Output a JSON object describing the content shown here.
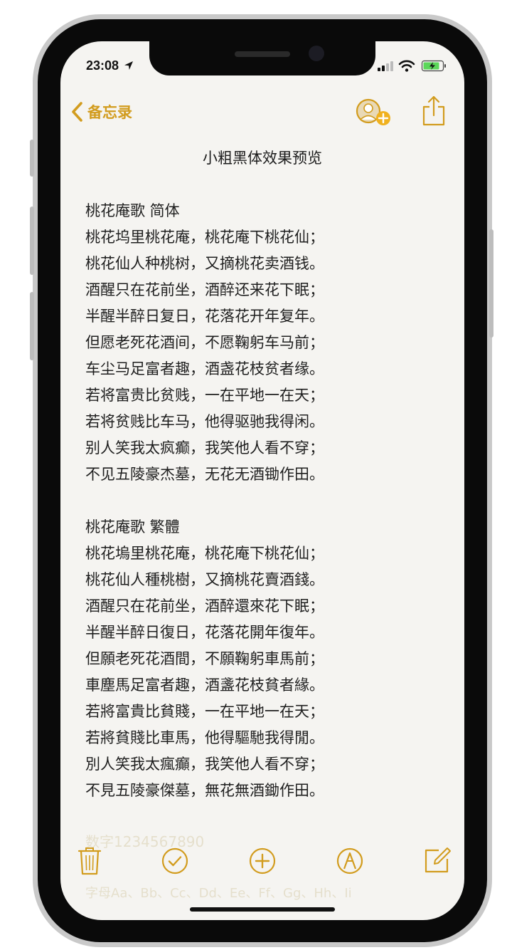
{
  "status_bar": {
    "time": "23:08"
  },
  "nav": {
    "back_label": "备忘录"
  },
  "note": {
    "title": "小粗黑体效果预览",
    "sections": [
      {
        "heading": "桃花庵歌  简体",
        "lines": [
          "桃花坞里桃花庵，桃花庵下桃花仙；",
          "桃花仙人种桃树，又摘桃花卖酒钱。",
          "酒醒只在花前坐，酒醉还来花下眠；",
          "半醒半醉日复日，花落花开年复年。",
          "但愿老死花酒间，不愿鞠躬车马前；",
          "车尘马足富者趣，酒盏花枝贫者缘。",
          "若将富贵比贫贱，一在平地一在天；",
          "若将贫贱比车马，他得驱驰我得闲。",
          "别人笑我太疯癫，我笑他人看不穿；",
          "不见五陵豪杰墓，无花无酒锄作田。"
        ]
      },
      {
        "heading": "桃花庵歌  繁體",
        "lines": [
          "桃花塢里桃花庵，桃花庵下桃花仙；",
          "桃花仙人種桃樹，又摘桃花賣酒錢。",
          "酒醒只在花前坐，酒醉還來花下眠；",
          "半醒半醉日復日，花落花開年復年。",
          "但願老死花酒間，不願鞠躬車馬前；",
          "車塵馬足富者趣，酒盞花枝貧者緣。",
          "若將富貴比貧賤，一在平地一在天；",
          "若將貧賤比車馬，他得驅馳我得閒。",
          "別人笑我太瘋癲，我笑他人看不穿；",
          "不見五陵豪傑墓，無花無酒鋤作田。"
        ]
      }
    ],
    "faded_lines": [
      "数字1234567890",
      "字母Aa、Bb、Cc、Dd、Ee、Ff、Gg、Hh、Ii"
    ]
  },
  "colors": {
    "accent": "#d29c1e",
    "text": "#1f1f1f",
    "background": "#f5f4f1"
  },
  "icons": {
    "back": "chevron-left-icon",
    "add_person": "person-add-icon",
    "share": "share-icon",
    "trash": "trash-icon",
    "checklist": "checkmark-circle-icon",
    "add": "plus-circle-icon",
    "markup": "pen-circle-icon",
    "compose": "compose-icon"
  }
}
